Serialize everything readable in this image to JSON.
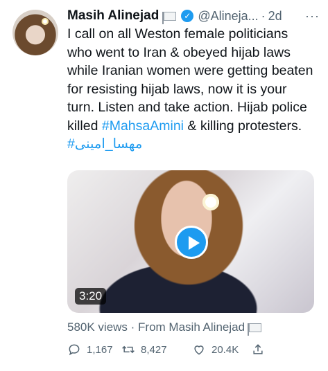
{
  "tweet": {
    "author_name": "Masih Alinejad",
    "handle": "@Alineja...",
    "separator": "·",
    "time": "2d",
    "more": "···",
    "text_lines": [
      "I call on all Weston female politicians",
      "who went to Iran & obeyed hijab laws",
      "while Iranian women were getting beaten",
      "for resisting hijab laws, now it is your",
      "turn. Listen and take action. Hijab police",
      "killed"
    ],
    "hashtag_1": "#MahsaAmini",
    "text_after_hashtag": "& killing protesters.",
    "hashtag_2": "#مهسا_امینی"
  },
  "media": {
    "duration": "3:20"
  },
  "views": {
    "text": "580K views · From Masih Alinejad"
  },
  "actions": {
    "replies": "1,167",
    "retweets": "8,427",
    "likes": "20.4K"
  },
  "colors": {
    "accent": "#1d9bf0",
    "text": "#0f1419",
    "secondary": "#536471"
  }
}
